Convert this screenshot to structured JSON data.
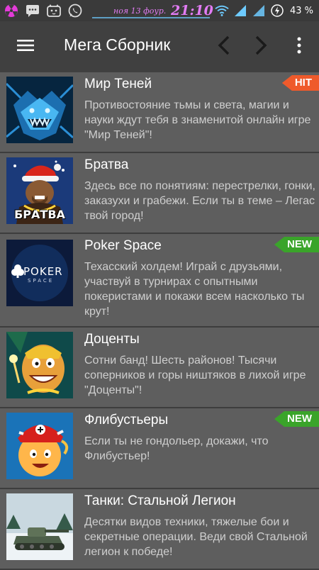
{
  "status_bar": {
    "date_text": "ноя 13 фоур.",
    "time": "21:10",
    "battery_percent": "43 %"
  },
  "toolbar": {
    "title": "Мега Сборник"
  },
  "items": [
    {
      "title": "Мир Теней",
      "description": "Противостояние тьмы и света, магии и науки ждут тебя в знаменитой онлайн игре \"Мир Теней\"!",
      "badge": "HIT"
    },
    {
      "title": "Братва",
      "description": "Здесь все по понятиям: перестрелки, гонки, заказухи и грабежи. Если ты в теме – Легас твой город!",
      "badge": "",
      "thumb_text": "БРАТВА"
    },
    {
      "title": "Poker Space",
      "description": "Техасский холдем! Играй с друзьями, участвуй в турнирах с опытными покеристами и покажи всем насколько ты крут!",
      "badge": "NEW",
      "thumb_text": "POKER",
      "thumb_subtext": "SPACE"
    },
    {
      "title": "Доценты",
      "description": "Сотни банд! Шесть районов! Тысячи соперников и горы ништяков в лихой игре \"Доценты\"!",
      "badge": ""
    },
    {
      "title": "Флибустьеры",
      "description": "Если ты не гондольер, докажи, что Флибустьер!",
      "badge": "NEW"
    },
    {
      "title": "Танки: Стальной Легион",
      "description": "Десятки видов техники, тяжелые бои и секретные операции. Веди свой Стальной легион к победе!",
      "badge": ""
    }
  ],
  "colors": {
    "hit_badge": "#ef5a2b",
    "new_badge": "#3aa42a",
    "toolbar": "#404040",
    "list_bg": "#5e5e5e"
  }
}
